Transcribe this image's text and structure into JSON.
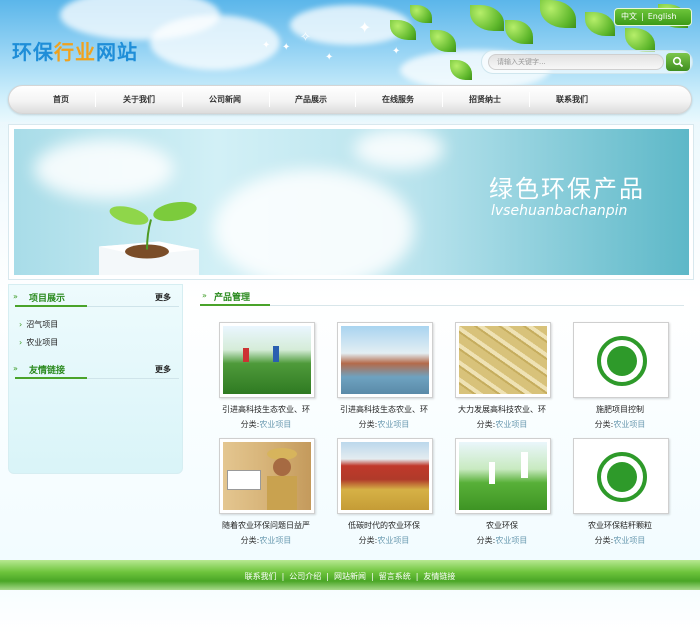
{
  "site": {
    "logo_part1": "环保",
    "logo_part2": "行业",
    "logo_part3": "网站"
  },
  "lang": {
    "zh": "中文",
    "en": "English"
  },
  "search": {
    "placeholder": "请输入关键字..."
  },
  "nav": {
    "items": [
      "首页",
      "关于我们",
      "公司新闻",
      "产品展示",
      "在线服务",
      "招贤纳士",
      "联系我们"
    ]
  },
  "banner": {
    "title": "绿色环保产品",
    "subtitle": "lvsehuanbachanpin"
  },
  "sidebar": {
    "projects_title": "项目展示",
    "projects_more": "更多",
    "projects_items": [
      "沼气项目",
      "农业项目"
    ],
    "links_title": "友情链接",
    "links_more": "更多"
  },
  "products": {
    "title": "产品管理",
    "category_label": "分类:",
    "items": [
      {
        "name": "引进高科技生态农业、环",
        "category": "农业项目"
      },
      {
        "name": "引进高科技生态农业、环",
        "category": "农业项目"
      },
      {
        "name": "大力发展高科技农业、环",
        "category": "农业项目"
      },
      {
        "name": "施肥项目控制",
        "category": "农业项目"
      },
      {
        "name": "随着农业环保问题日益严",
        "category": "农业项目"
      },
      {
        "name": "低碳时代的农业环保",
        "category": "农业项目"
      },
      {
        "name": "农业环保",
        "category": "农业项目"
      },
      {
        "name": "农业环保秸秆颗粒",
        "category": "农业项目"
      }
    ]
  },
  "footer": {
    "links": [
      "联系我们",
      "公司介绍",
      "网站新闻",
      "留言系统",
      "友情链接"
    ],
    "separator": "|"
  },
  "colors": {
    "accent_green": "#4aa32a",
    "link_blue": "#6a9ab0"
  }
}
